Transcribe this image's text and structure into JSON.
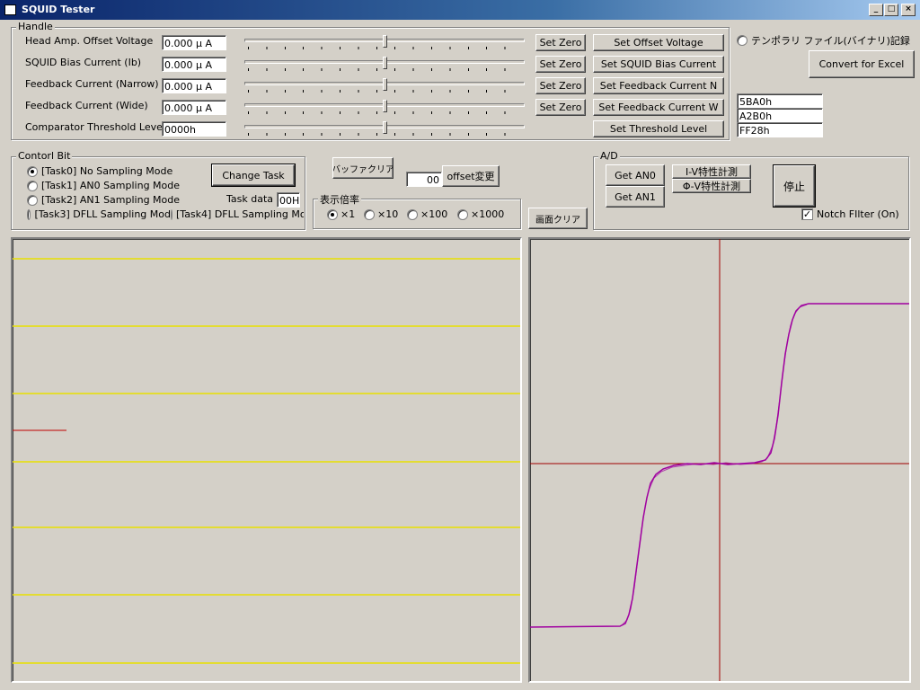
{
  "window": {
    "title": "SQUID Tester",
    "minimize": "_",
    "maximize": "□",
    "close": "×"
  },
  "handle": {
    "label": "Handle",
    "rows": [
      {
        "label": "Head Amp. Offset Voltage",
        "value": "0.000 μ A",
        "zero": "Set Zero",
        "set": "Set Offset Voltage"
      },
      {
        "label": "SQUID Bias Current (Ib)",
        "value": "0.000 μ A",
        "zero": "Set Zero",
        "set": "Set SQUID Bias Current"
      },
      {
        "label": "Feedback Current  (Narrow)",
        "value": "0.000 μ A",
        "zero": "Set Zero",
        "set": "Set Feedback Current N"
      },
      {
        "label": "Feedback Current  (Wide)",
        "value": "0.000 μ A",
        "zero": "Set Zero",
        "set": "Set Feedback Current W"
      },
      {
        "label": "Comparator Threshold Level",
        "value": "0000h",
        "zero": "",
        "set": "Set Threshold Level"
      }
    ],
    "slider_level": 0.5
  },
  "temp_file": {
    "label": "テンポラリ ファイル(バイナリ)記録",
    "checked": false
  },
  "convert_excel": "Convert for Excel",
  "hex_values": [
    "5BA0h",
    "A2B0h",
    "FF28h"
  ],
  "control_bit": {
    "label": "Contorl Bit",
    "tasks": [
      {
        "label": "[Task0] No Sampling Mode",
        "selected": true
      },
      {
        "label": "[Task1] AN0 Sampling Mode",
        "selected": false
      },
      {
        "label": "[Task2] AN1 Sampling Mode",
        "selected": false
      },
      {
        "label": "[Task3] DFLL Sampling Mod",
        "selected": false
      },
      {
        "label": "[Task4] DFLL Sampling Mo",
        "selected": false
      }
    ],
    "change_task": "Change Task",
    "task_data_label": "Task data",
    "task_data_value": "00H"
  },
  "buffer_clear": "バッファクリア",
  "offset": {
    "value": "00",
    "button": "offset変更"
  },
  "magnification": {
    "label": "表示倍率",
    "options": [
      {
        "label": "×1",
        "selected": true
      },
      {
        "label": "×10",
        "selected": false
      },
      {
        "label": "×100",
        "selected": false
      },
      {
        "label": "×1000",
        "selected": false
      }
    ]
  },
  "screen_clear": "画面クリア",
  "ad": {
    "label": "A/D",
    "get_an0": "Get AN0",
    "get_an1": "Get AN1",
    "iv": "I-V特性計測",
    "phiv": "Φ-V特性計測",
    "stop": "停止",
    "notch_label": "Notch FIlter (On)",
    "notch_checked": true
  },
  "colors": {
    "trace": "#a000a0",
    "axis": "#a00000",
    "grid": "#e8e000",
    "marker": "#c00000"
  }
}
